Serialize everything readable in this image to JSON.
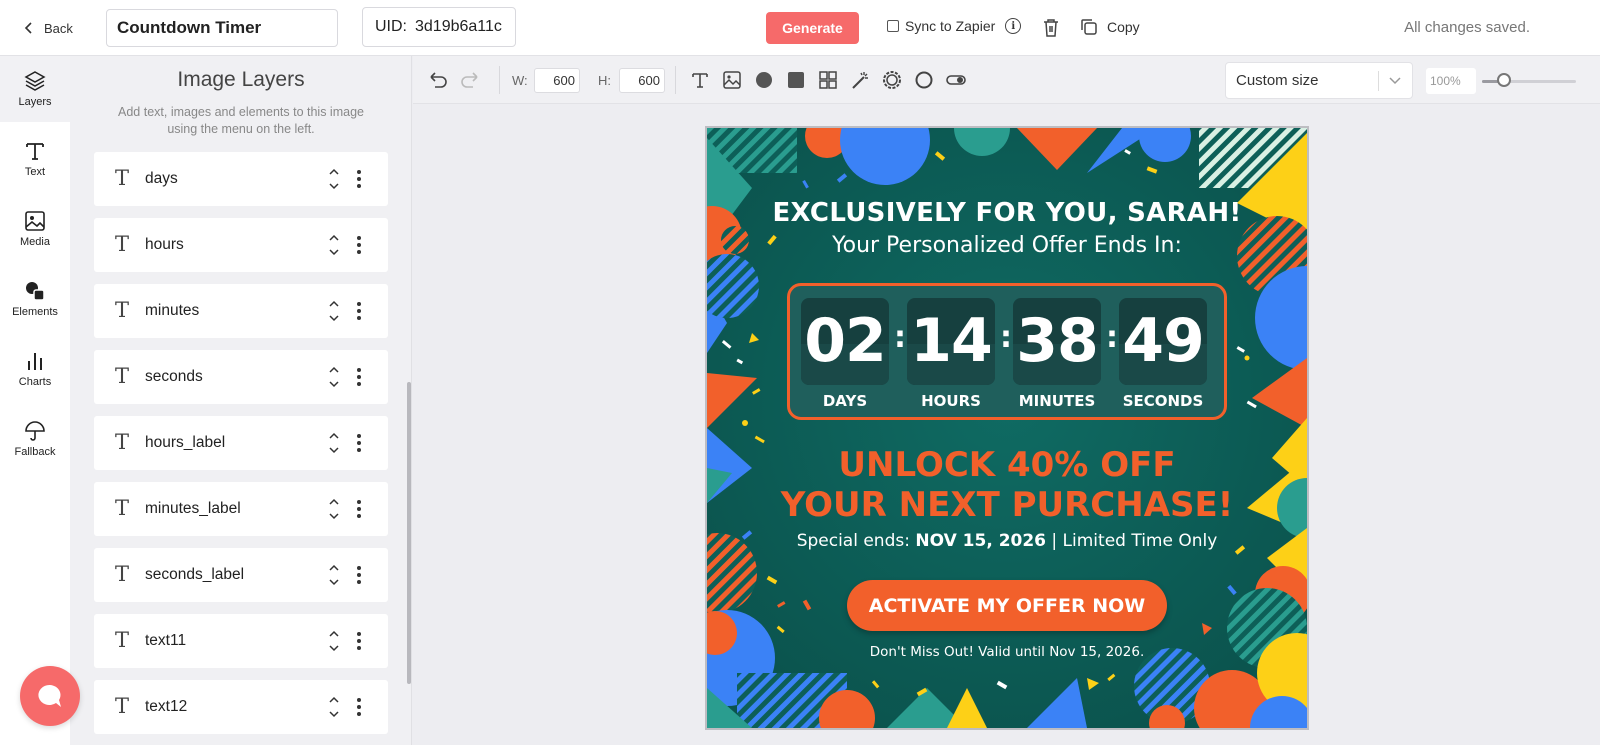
{
  "topbar": {
    "back_label": "Back",
    "template_name": "Countdown Timer",
    "uid_label": "UID:",
    "uid_value": "3d19b6a11c",
    "generate_label": "Generate",
    "sync_label": "Sync to Zapier",
    "copy_label": "Copy",
    "status": "All changes saved."
  },
  "rail": {
    "items": [
      {
        "label": "Layers",
        "icon": "layers-icon"
      },
      {
        "label": "Text",
        "icon": "text-icon"
      },
      {
        "label": "Media",
        "icon": "image-icon"
      },
      {
        "label": "Elements",
        "icon": "shapes-icon"
      },
      {
        "label": "Charts",
        "icon": "bar-chart-icon"
      },
      {
        "label": "Fallback",
        "icon": "umbrella-icon"
      }
    ]
  },
  "panel": {
    "title": "Image Layers",
    "subtitle": "Add text, images and elements to this image using the menu on the left.",
    "layers": [
      {
        "name": "days"
      },
      {
        "name": "hours"
      },
      {
        "name": "minutes"
      },
      {
        "name": "seconds"
      },
      {
        "name": "hours_label"
      },
      {
        "name": "minutes_label"
      },
      {
        "name": "seconds_label"
      },
      {
        "name": "text11"
      },
      {
        "name": "text12"
      }
    ]
  },
  "toolbar": {
    "width_label": "W:",
    "width_value": "600",
    "height_label": "H:",
    "height_value": "600",
    "size_option": "Custom size",
    "zoom_value": "100%",
    "zoom_fraction": 0.23
  },
  "canvas": {
    "headline": "EXCLUSIVELY FOR YOU, SARAH!",
    "subheadline": "Your Personalized Offer Ends In:",
    "timer": {
      "days": "02",
      "hours": "14",
      "minutes": "38",
      "seconds": "49",
      "days_label": "DAYS",
      "hours_label": "HOURS",
      "minutes_label": "MINUTES",
      "seconds_label": "SECONDS"
    },
    "offer_line1": "UNLOCK 40% OFF",
    "offer_line2": "YOUR NEXT PURCHASE!",
    "special_prefix": "Special ends:",
    "special_date": "NOV 15, 2026",
    "special_suffix": "| Limited Time Only",
    "cta_label": "ACTIVATE MY OFFER NOW",
    "footer": "Don't Miss Out! Valid until Nov 15, 2026."
  },
  "colors": {
    "accent": "#f66a6a",
    "canvas_bg": "#0d5f58",
    "orange": "#f2602b",
    "blue": "#3b82f6",
    "yellow": "#fdd017"
  }
}
